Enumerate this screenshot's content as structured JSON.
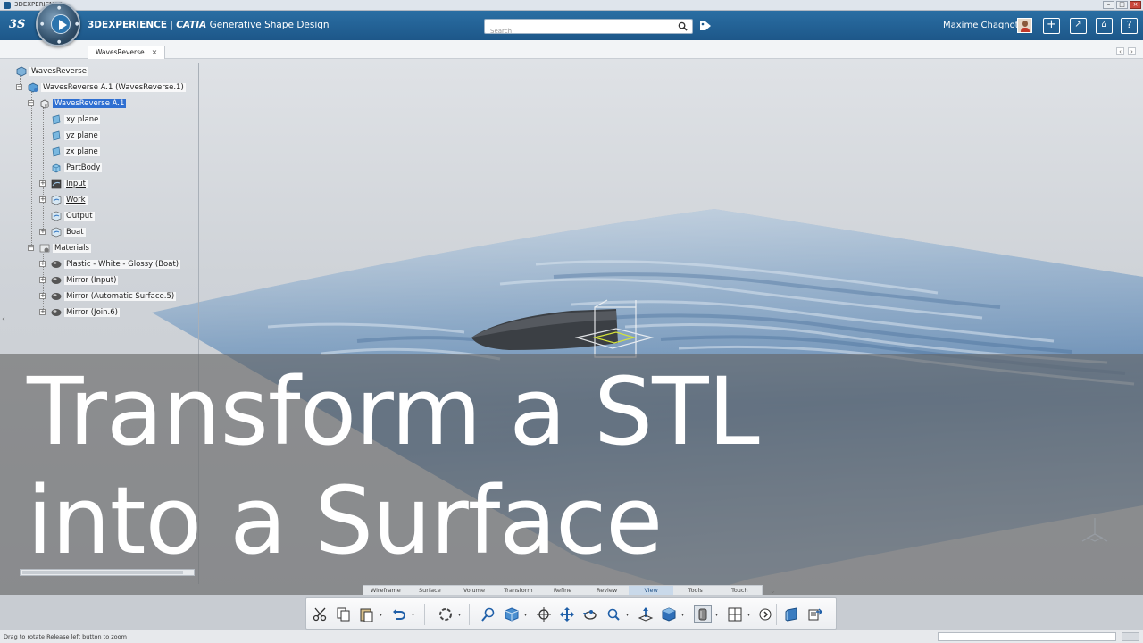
{
  "os": {
    "title": "3DEXPERIENCE"
  },
  "header": {
    "brand": "3DEXPERIENCE",
    "separator": " | ",
    "product": "CATIA",
    "app": " Generative Shape Design",
    "search_placeholder": "Search",
    "user": "Maxime Chagnot"
  },
  "tabs": {
    "active": "WavesReverse"
  },
  "tree": {
    "items": [
      {
        "label": "WavesReverse"
      },
      {
        "label": "WavesReverse A.1 (WavesReverse.1)"
      },
      {
        "label": "WavesReverse A.1"
      },
      {
        "label": "xy plane"
      },
      {
        "label": "yz plane"
      },
      {
        "label": "zx plane"
      },
      {
        "label": "PartBody"
      },
      {
        "label": "Input"
      },
      {
        "label": "Work"
      },
      {
        "label": "Output"
      },
      {
        "label": "Boat"
      },
      {
        "label": "Materials"
      },
      {
        "label": "Plastic - White - Glossy (Boat)"
      },
      {
        "label": "Mirror (Input)"
      },
      {
        "label": "Mirror (Automatic Surface.5)"
      },
      {
        "label": "Mirror (Join.6)"
      }
    ]
  },
  "overlay": {
    "line1": "Transform a STL",
    "line2": "into a Surface"
  },
  "section_tabs": [
    "Wireframe",
    "Surface",
    "Volume",
    "Transform",
    "Refine",
    "Review",
    "View",
    "Tools",
    "Touch"
  ],
  "active_section": "View",
  "status": {
    "text": "Drag to rotate  Release left button to zoom"
  },
  "colors": {
    "header": "#1d5789",
    "selection": "#2f6fd1",
    "water": "#5e88b4"
  }
}
